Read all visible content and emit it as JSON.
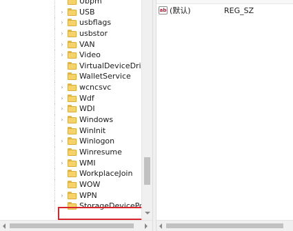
{
  "tree": {
    "items": [
      {
        "label": "Ubpm",
        "expandable": false
      },
      {
        "label": "USB",
        "expandable": true
      },
      {
        "label": "usbflags",
        "expandable": true
      },
      {
        "label": "usbstor",
        "expandable": true
      },
      {
        "label": "VAN",
        "expandable": true
      },
      {
        "label": "Video",
        "expandable": true
      },
      {
        "label": "VirtualDeviceDrivers",
        "expandable": false
      },
      {
        "label": "WalletService",
        "expandable": false
      },
      {
        "label": "wcncsvc",
        "expandable": true
      },
      {
        "label": "Wdf",
        "expandable": true
      },
      {
        "label": "WDI",
        "expandable": true
      },
      {
        "label": "Windows",
        "expandable": true
      },
      {
        "label": "WinInit",
        "expandable": false
      },
      {
        "label": "Winlogon",
        "expandable": true
      },
      {
        "label": "Winresume",
        "expandable": false
      },
      {
        "label": "WMI",
        "expandable": true
      },
      {
        "label": "WorkplaceJoin",
        "expandable": false
      },
      {
        "label": "WOW",
        "expandable": false
      },
      {
        "label": "WPN",
        "expandable": true
      },
      {
        "label": "StorageDevicePolici",
        "expandable": false,
        "new": true
      }
    ]
  },
  "values": {
    "rows": [
      {
        "icon": "string-value-icon",
        "icon_text": "ab",
        "name": "(默认)",
        "type": "REG_SZ"
      }
    ]
  },
  "colors": {
    "highlight_frame": "#d8232a",
    "folder_fill": "#f5d36a"
  }
}
